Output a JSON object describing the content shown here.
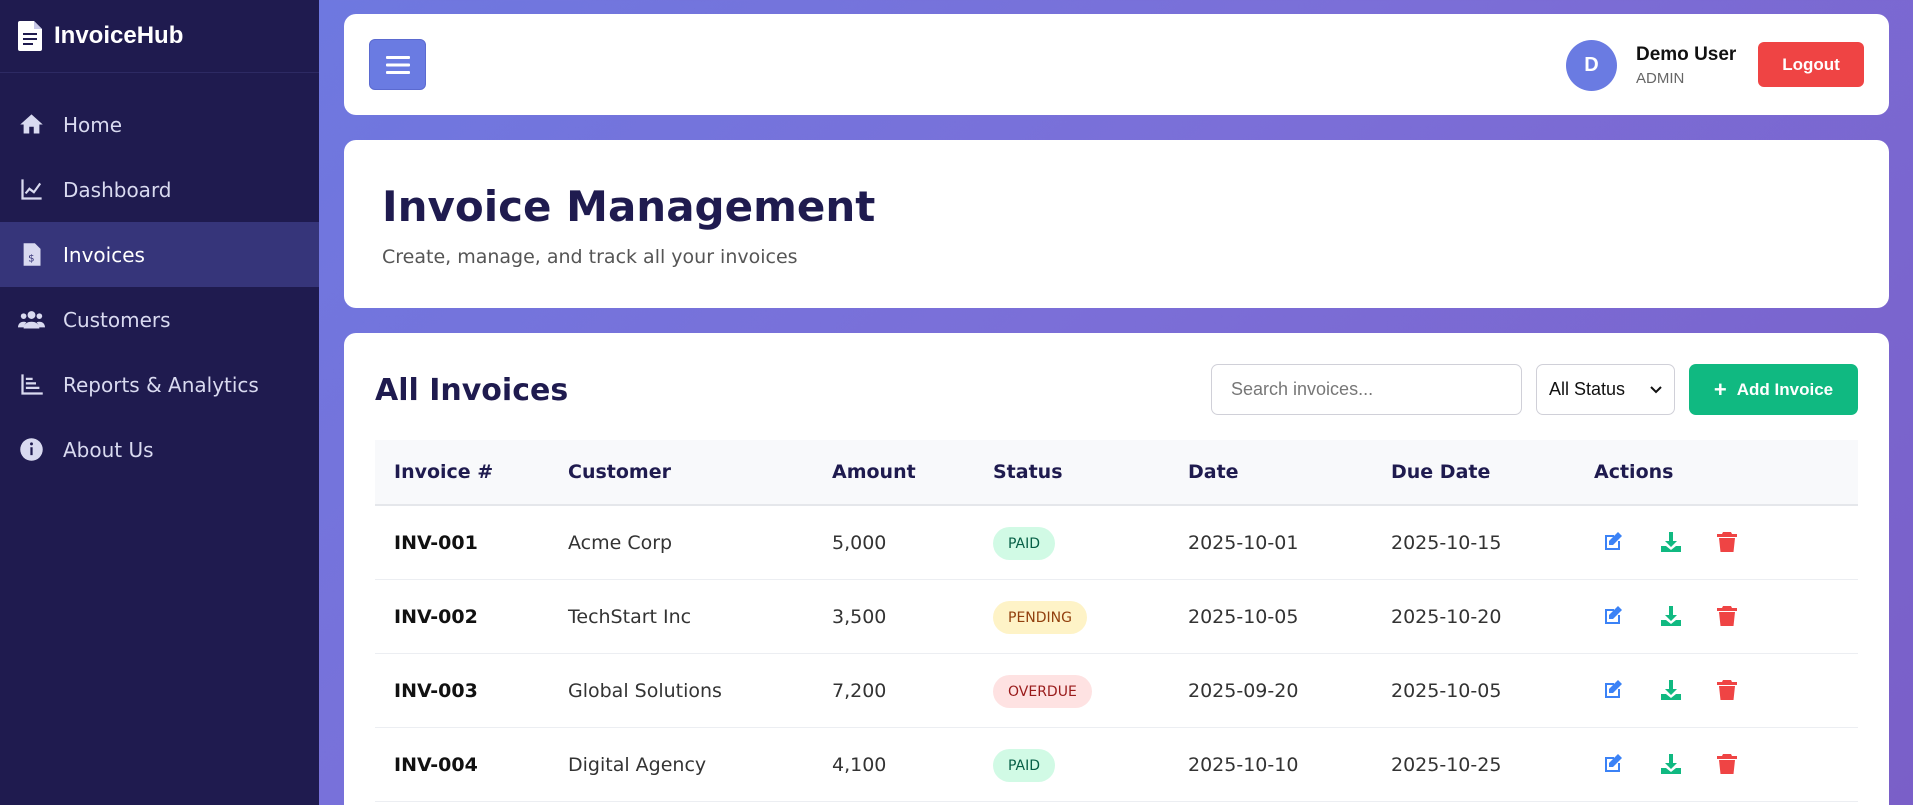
{
  "app": {
    "name": "InvoiceHub"
  },
  "sidebar": {
    "items": [
      {
        "label": "Home",
        "icon": "home-icon",
        "active": false
      },
      {
        "label": "Dashboard",
        "icon": "chart-line-icon",
        "active": false
      },
      {
        "label": "Invoices",
        "icon": "invoice-icon",
        "active": true
      },
      {
        "label": "Customers",
        "icon": "users-icon",
        "active": false
      },
      {
        "label": "Reports & Analytics",
        "icon": "chart-bar-icon",
        "active": false
      },
      {
        "label": "About Us",
        "icon": "info-icon",
        "active": false
      }
    ]
  },
  "topbar": {
    "user_initial": "D",
    "user_name": "Demo User",
    "user_role": "ADMIN",
    "logout_label": "Logout"
  },
  "header": {
    "title": "Invoice Management",
    "subtitle": "Create, manage, and track all your invoices"
  },
  "invoices_section": {
    "title": "All Invoices",
    "search_placeholder": "Search invoices...",
    "status_filter": "All Status",
    "add_label": "Add Invoice"
  },
  "table": {
    "columns": [
      "Invoice #",
      "Customer",
      "Amount",
      "Status",
      "Date",
      "Due Date",
      "Actions"
    ],
    "rows": [
      {
        "id": "INV-001",
        "customer": "Acme Corp",
        "amount": "5,000",
        "status": "PAID",
        "date": "2025-10-01",
        "due": "2025-10-15"
      },
      {
        "id": "INV-002",
        "customer": "TechStart Inc",
        "amount": "3,500",
        "status": "PENDING",
        "date": "2025-10-05",
        "due": "2025-10-20"
      },
      {
        "id": "INV-003",
        "customer": "Global Solutions",
        "amount": "7,200",
        "status": "OVERDUE",
        "date": "2025-09-20",
        "due": "2025-10-05"
      },
      {
        "id": "INV-004",
        "customer": "Digital Agency",
        "amount": "4,100",
        "status": "PAID",
        "date": "2025-10-10",
        "due": "2025-10-25"
      }
    ]
  },
  "colors": {
    "sidebar_bg": "#1f1b4f",
    "accent": "#6a7be2",
    "danger": "#ef4444",
    "success": "#10b981",
    "edit_icon": "#3b82f6"
  }
}
